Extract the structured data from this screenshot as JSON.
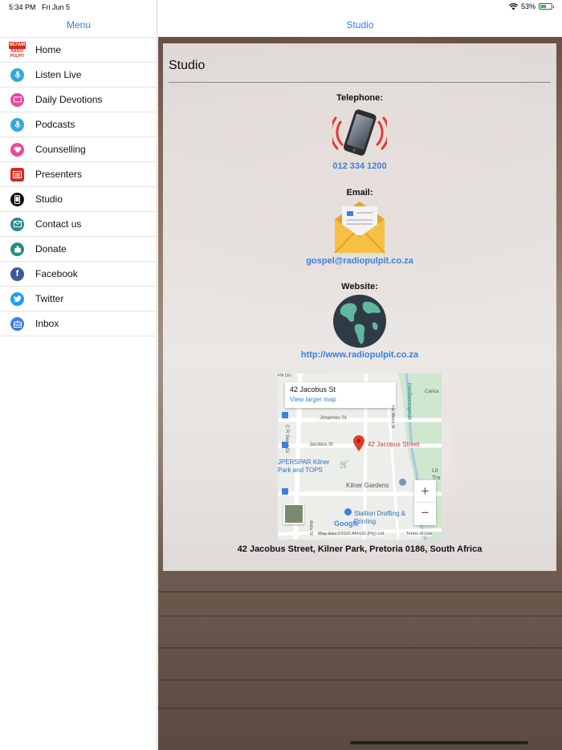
{
  "status": {
    "time": "5:34 PM",
    "date": "Fri Jun 5",
    "battery": "53%"
  },
  "sidebar": {
    "title": "Menu",
    "logo": {
      "line1": "657AM",
      "line2": "RADIO",
      "line3": "PULPIT"
    },
    "items": [
      {
        "label": "Home",
        "icon": "radio-pulpit-logo-icon"
      },
      {
        "label": "Listen Live",
        "icon": "microphone-icon",
        "color": "#33a9d8"
      },
      {
        "label": "Daily Devotions",
        "icon": "book-icon",
        "color": "#e8489a"
      },
      {
        "label": "Podcasts",
        "icon": "microphone-icon",
        "color": "#33a9d8"
      },
      {
        "label": "Counselling",
        "icon": "heart-icon",
        "color": "#e8489a"
      },
      {
        "label": "Presenters",
        "icon": "presenters-icon",
        "color": "#d9291c"
      },
      {
        "label": "Studio",
        "icon": "phone-icon",
        "color": "#111111"
      },
      {
        "label": "Contact us",
        "icon": "envelope-icon",
        "color": "#2a8a8a"
      },
      {
        "label": "Donate",
        "icon": "donate-icon",
        "color": "#2a8a8a"
      },
      {
        "label": "Facebook",
        "icon": "facebook-icon",
        "color": "#3b5998"
      },
      {
        "label": "Twitter",
        "icon": "twitter-icon",
        "color": "#1da1f2"
      },
      {
        "label": "Inbox",
        "icon": "inbox-icon",
        "color": "#3b7fe0"
      }
    ]
  },
  "main": {
    "nav_title": "Studio",
    "heading": "Studio",
    "telephone": {
      "label": "Telephone:",
      "value": "012 334 1200"
    },
    "email": {
      "label": "Email:",
      "value": "gospel@radiopulpit.co.za"
    },
    "website": {
      "label": "Website:",
      "value": "http://www.radiopulpit.co.za"
    },
    "map": {
      "place_title": "42 Jacobus St",
      "larger_map": "View larger map",
      "pin_label": "42 Jacobus Street",
      "streets": [
        "Johannes St",
        "Jacobus St",
        "C R Swart Dr",
        "Hartbeesspruit",
        "Carica",
        "Ina Wilers St",
        "Ahilla St",
        "Whitefish St",
        "Pe Du"
      ],
      "places": [
        "JPERSPAR Kilner Park and TOPS",
        "Kilner Gardens",
        "Stallion Drafting & Printing",
        "Lit Tra"
      ],
      "brand": "Google",
      "footer": "Map data ©2020 AfriGIS (Pty) Ltd",
      "terms": "Terms of Use",
      "zoom_in": "+",
      "zoom_out": "−"
    },
    "address": "42 Jacobus Street, Kilner Park, Pretoria 0186, South Africa"
  }
}
